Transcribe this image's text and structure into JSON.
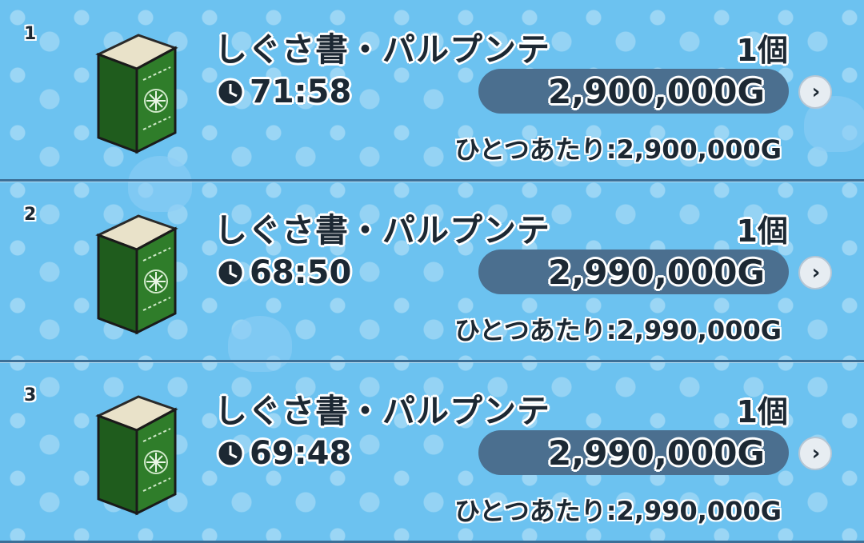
{
  "listings": [
    {
      "rank": "1",
      "item_name": "しぐさ書・パルプンテ",
      "quantity": "1個",
      "time_left": "71:58",
      "price": "2,900,000G",
      "per_unit": "ひとつあたり:2,900,000G"
    },
    {
      "rank": "2",
      "item_name": "しぐさ書・パルプンテ",
      "quantity": "1個",
      "time_left": "68:50",
      "price": "2,990,000G",
      "per_unit": "ひとつあたり:2,990,000G"
    },
    {
      "rank": "3",
      "item_name": "しぐさ書・パルプンテ",
      "quantity": "1個",
      "time_left": "69:48",
      "price": "2,990,000G",
      "per_unit": "ひとつあたり:2,990,000G"
    }
  ],
  "icons": {
    "item": "green-book-icon",
    "timer": "clock-icon",
    "detail": "chevron-right-icon"
  },
  "colors": {
    "background": "#6cc2f0",
    "price_pill": "#4b6f8f",
    "text": "#1c2833",
    "book": "#2f7d2a"
  }
}
